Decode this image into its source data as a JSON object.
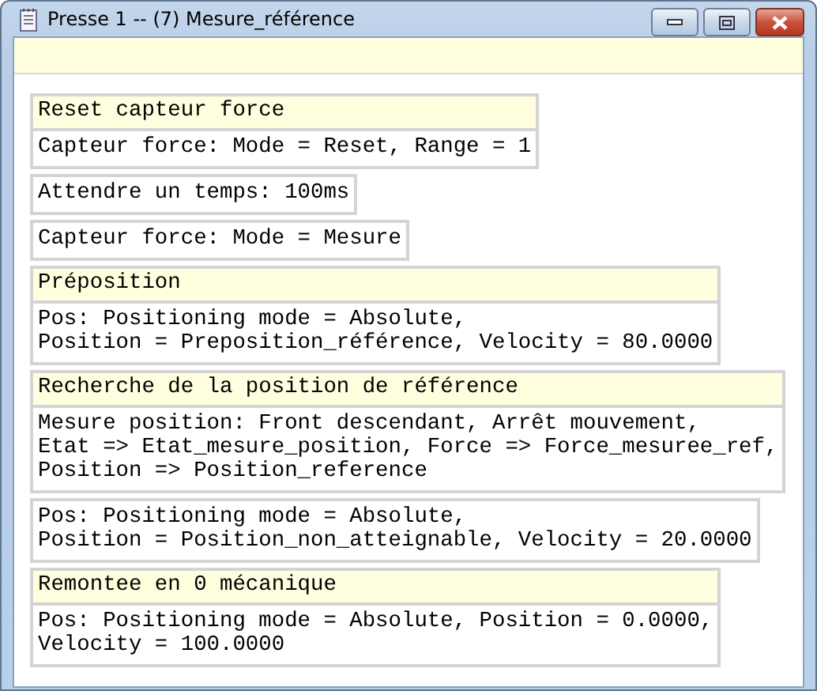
{
  "window": {
    "title": "Presse 1 -- (7) Mesure_référence"
  },
  "blocks": [
    {
      "title": "Reset capteur force",
      "lines": [
        "Capteur force: Mode = Reset, Range = 1"
      ]
    },
    {
      "lines": [
        "Attendre un temps: 100ms"
      ]
    },
    {
      "lines": [
        "Capteur force: Mode = Mesure"
      ]
    },
    {
      "title": "Préposition",
      "lines": [
        "Pos: Positioning mode = Absolute,",
        "Position = Preposition_référence, Velocity = 80.0000"
      ]
    },
    {
      "title": "Recherche de la position de référence",
      "lines": [
        "Mesure position: Front descendant, Arrêt mouvement,",
        "Etat => Etat_mesure_position, Force => Force_mesuree_ref,",
        "Position => Position_reference"
      ]
    },
    {
      "lines": [
        "Pos: Positioning mode = Absolute,",
        "Position = Position_non_atteignable, Velocity = 20.0000"
      ]
    },
    {
      "title": "Remontee en 0 mécanique",
      "lines": [
        "Pos: Positioning mode = Absolute, Position = 0.0000,",
        "Velocity = 100.0000"
      ]
    }
  ]
}
